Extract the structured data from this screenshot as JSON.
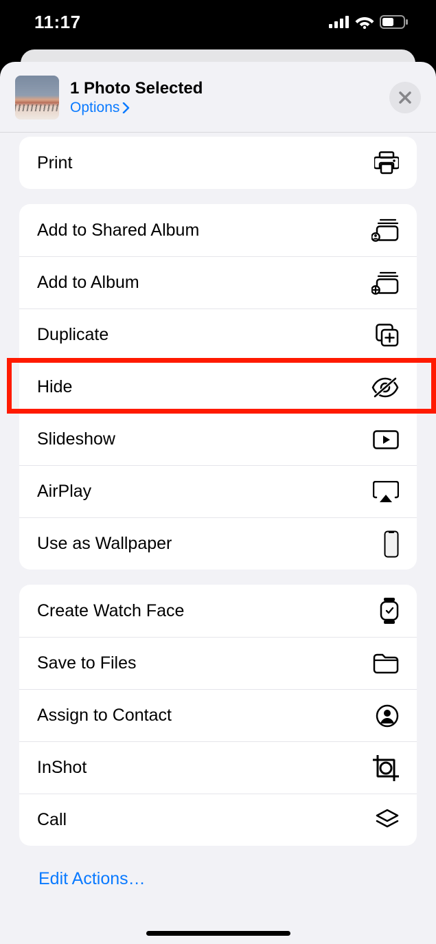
{
  "status": {
    "time": "11:17"
  },
  "header": {
    "title": "1 Photo Selected",
    "options_label": "Options"
  },
  "actions": {
    "print": "Print",
    "add_shared": "Add to Shared Album",
    "add_album": "Add to Album",
    "duplicate": "Duplicate",
    "hide": "Hide",
    "slideshow": "Slideshow",
    "airplay": "AirPlay",
    "wallpaper": "Use as Wallpaper",
    "watch_face": "Create Watch Face",
    "save_files": "Save to Files",
    "assign_contact": "Assign to Contact",
    "inshot": "InShot",
    "call": "Call"
  },
  "footer": {
    "edit_actions": "Edit Actions…"
  },
  "highlighted_action": "hide"
}
